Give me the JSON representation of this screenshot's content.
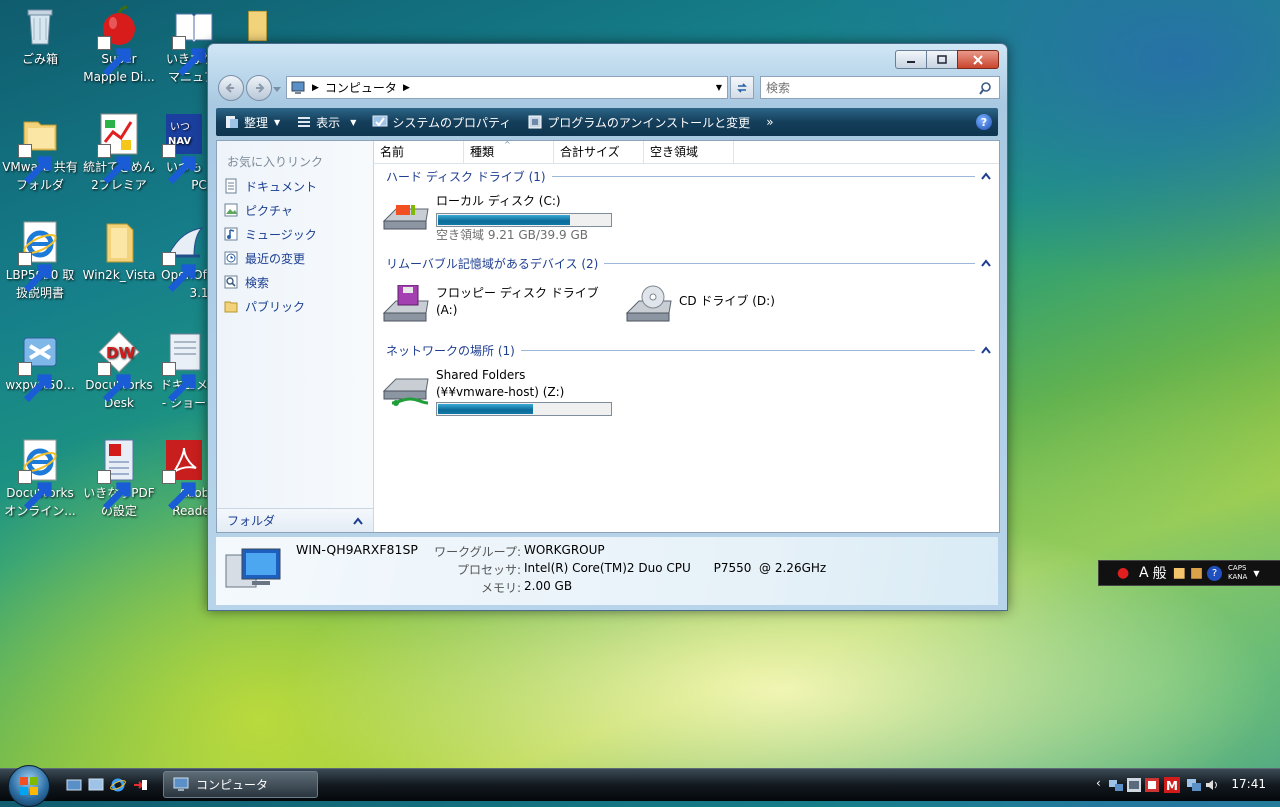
{
  "desktop": {
    "icons": [
      {
        "label1": "ごみ箱",
        "label2": ""
      },
      {
        "label1": "Super",
        "label2": "Mapple Di..."
      },
      {
        "label1": "いきなりP",
        "label2": "マニュア"
      },
      {
        "label1": "",
        "label2": ""
      },
      {
        "label1": "VMware 共有",
        "label2": "フォルダ"
      },
      {
        "label1": "統計てきめん",
        "label2": "2プレミア"
      },
      {
        "label1": "いつも",
        "label2": "PC"
      },
      {
        "label1": "LBP5050 取",
        "label2": "扱説明書"
      },
      {
        "label1": "Win2k_Vista",
        "label2": ""
      },
      {
        "label1": "OpenOf",
        "label2": "3.1"
      },
      {
        "label1": "wxpvst50...",
        "label2": ""
      },
      {
        "label1": "DocuWorks",
        "label2": "Desk"
      },
      {
        "label1": "ドキュメ",
        "label2": "- ショー"
      },
      {
        "label1": "DocuWorks",
        "label2": "オンライン..."
      },
      {
        "label1": "いきなりPDF",
        "label2": "の設定"
      },
      {
        "label1": "Adob",
        "label2": "Reade"
      }
    ]
  },
  "window": {
    "address": {
      "path": "コンピュータ"
    },
    "search": {
      "placeholder": "検索"
    },
    "toolbar": {
      "organize": "整理",
      "view": "表示",
      "system_properties": "システムのプロパティ",
      "uninstall": "プログラムのアンインストールと変更",
      "more": "»"
    },
    "favorites": {
      "title": "お気に入りリンク",
      "items": [
        "ドキュメント",
        "ピクチャ",
        "ミュージック",
        "最近の変更",
        "検索",
        "パブリック"
      ]
    },
    "folder_bar": "フォルダ",
    "columns": [
      "名前",
      "種類",
      "合計サイズ",
      "空き領域"
    ],
    "groups": {
      "hdd": "ハード ディスク ドライブ (1)",
      "removable": "リムーバブル記憶域があるデバイス (2)",
      "network": "ネットワークの場所 (1)"
    },
    "drives": {
      "c": {
        "name": "ローカル ディスク (C:)",
        "free": "空き領域 9.21 GB/39.9 GB",
        "used_fraction": 0.77
      },
      "floppy": {
        "name": "フロッピー ディスク ドライブ",
        "name2": "(A:)"
      },
      "cd": {
        "name": "CD ドライブ (D:)"
      },
      "z": {
        "name": "Shared Folders",
        "name2": "(¥¥vmware-host) (Z:)",
        "used_fraction": 0.56
      }
    },
    "details": {
      "computer_name": "WIN-QH9ARXF81SP",
      "workgroup_label": "ワークグループ:",
      "workgroup_value": "WORKGROUP",
      "processor_label": "プロセッサ:",
      "processor_value": "Intel(R) Core(TM)2 Duo CPU      P7550  @ 2.26GHz",
      "memory_label": "メモリ:",
      "memory_value": "2.00 GB"
    }
  },
  "taskbar": {
    "task_label": "コンピュータ",
    "clock": "17:41",
    "lang_mode": "般",
    "lang_a": "A",
    "caps": "CAPS",
    "kana": "KANA"
  },
  "colors": {
    "toolbar": "#143e5a",
    "link": "#1b3e91",
    "group": "#1e3e90",
    "progress": "#0b6a98"
  }
}
